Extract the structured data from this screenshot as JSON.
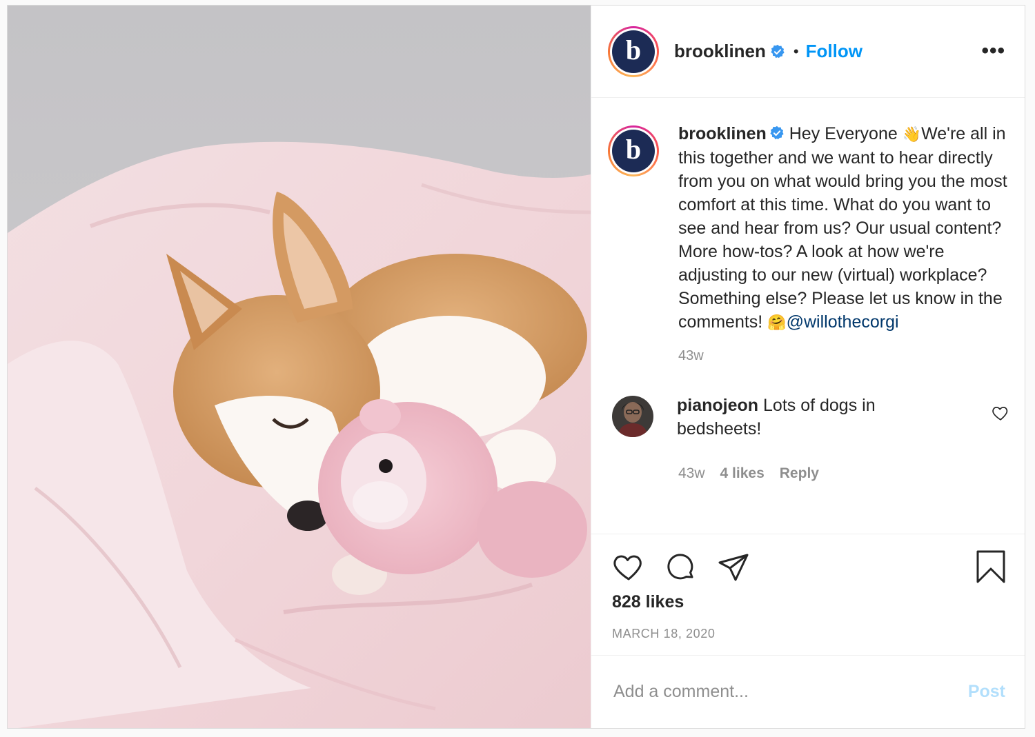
{
  "header": {
    "avatar_letter": "b",
    "username": "brooklinen",
    "separator": "•",
    "follow_label": "Follow",
    "more_label": "•••"
  },
  "caption": {
    "avatar_letter": "b",
    "username": "brooklinen",
    "text_part1": " Hey Everyone ",
    "emoji_wave": "👋",
    "text_part2": "We're all in this together and we want to hear directly from you on what would bring you the most comfort at this time. What do you want to see and hear from us? Our usual content? More how-tos? A look at how we're adjusting to our new (virtual) workplace? Something else? Please let us know in the comments! ",
    "emoji_hug": "🤗",
    "mention": "@willothecorgi",
    "time": "43w"
  },
  "reply": {
    "username": "pianojeon",
    "text": " Lots of dogs in bedsheets!",
    "time": "43w",
    "likes": "4 likes",
    "reply_label": "Reply"
  },
  "actions": {
    "icons": [
      "heart-icon",
      "comment-icon",
      "share-icon",
      "bookmark-icon"
    ],
    "likes": "828 likes",
    "date": "MARCH 18, 2020"
  },
  "add_comment": {
    "placeholder": "Add a comment...",
    "post_label": "Post"
  },
  "colors": {
    "link_blue": "#0095f6",
    "mention_blue": "#00376b",
    "post_disabled": "#b2dffc",
    "muted_gray": "#8e8e8e",
    "avatar_navy": "#1c2b55"
  }
}
